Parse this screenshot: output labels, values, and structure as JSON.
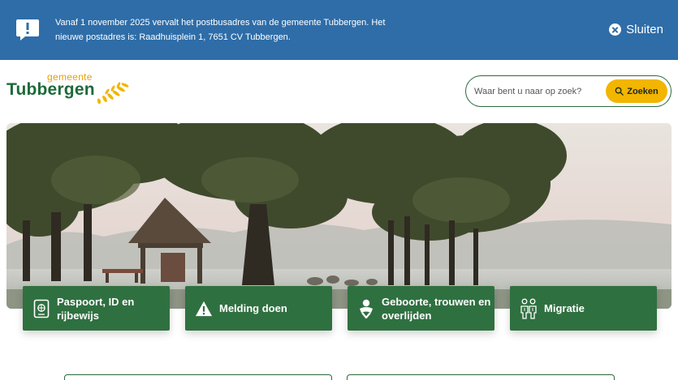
{
  "banner": {
    "message": "Vanaf 1 november 2025 vervalt het postbusadres van de gemeente Tubbergen. Het nieuwe postadres is: Raadhuisplein 1, 7651 CV Tubbergen.",
    "close_label": "Sluiten",
    "background": "#2e6da8"
  },
  "logo": {
    "small": "gemeente",
    "big": "Tubbergen"
  },
  "search": {
    "placeholder": "Waar bent u naar op zoek?",
    "button_label": "Zoeken"
  },
  "tiles": [
    {
      "label": "Paspoort, ID en rijbewijs",
      "icon": "passport-icon"
    },
    {
      "label": "Melding doen",
      "icon": "warning-icon"
    },
    {
      "label": "Geboorte, trouwen en overlijden",
      "icon": "baby-icon"
    },
    {
      "label": "Migratie",
      "icon": "people-icon"
    }
  ],
  "colors": {
    "brand_green": "#2f7040",
    "accent_yellow": "#f2b500",
    "banner_blue": "#2e6da8"
  }
}
